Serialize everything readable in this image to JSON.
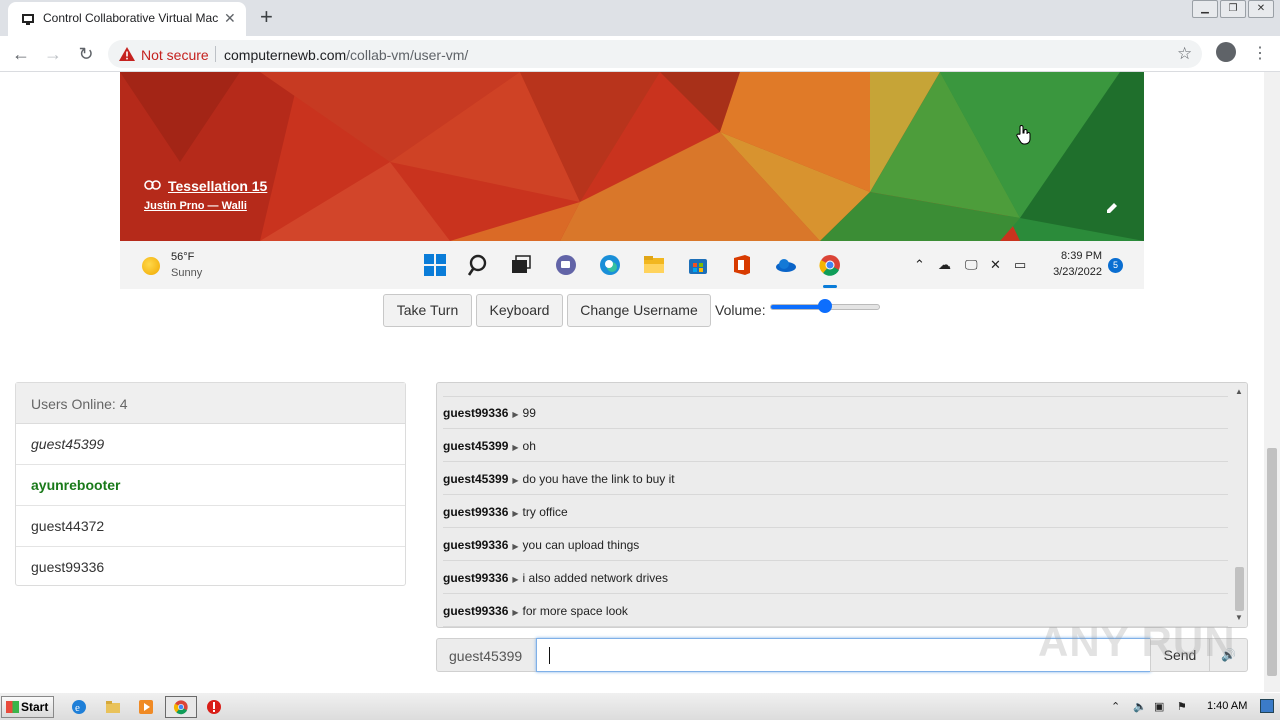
{
  "browser": {
    "tab_title": "Control Collaborative Virtual Machine",
    "security_label": "Not secure",
    "url_host": "computernewb.com",
    "url_path": "/collab-vm/user-vm/"
  },
  "vm": {
    "wallpaper": {
      "title": "Tessellation 15",
      "author": "Justin Prno — Walli"
    },
    "weather": {
      "temp": "56°F",
      "condition": "Sunny"
    },
    "taskbar_icons": [
      "windows-start-icon",
      "search-icon",
      "task-view-icon",
      "chat-icon",
      "edge-icon",
      "file-explorer-icon",
      "store-icon",
      "office-icon",
      "onedrive-icon",
      "chrome-icon"
    ],
    "clock": {
      "time": "8:39 PM",
      "date": "3/23/2022"
    },
    "notification_count": "5"
  },
  "controls": {
    "take_turn": "Take Turn",
    "keyboard": "Keyboard",
    "change_username": "Change Username",
    "volume_label": "Volume:",
    "volume_level": 0.5
  },
  "users": {
    "header": "Users Online: 4",
    "list": [
      "guest45399",
      "ayunrebooter",
      "guest44372",
      "guest99336"
    ]
  },
  "chat": {
    "messages": [
      {
        "user": "guest99336",
        "text": "99"
      },
      {
        "user": "guest45399",
        "text": "oh"
      },
      {
        "user": "guest45399",
        "text": "do you have the link to buy it"
      },
      {
        "user": "guest99336",
        "text": "try office"
      },
      {
        "user": "guest99336",
        "text": "you can upload things"
      },
      {
        "user": "guest99336",
        "text": "i also added network drives"
      },
      {
        "user": "guest99336",
        "text": "for more space look"
      }
    ],
    "input_username": "guest45399",
    "input_value": "",
    "send_label": "Send"
  },
  "watermark": "ANY RUN",
  "os_taskbar": {
    "start_label": "Start",
    "clock": "1:40 AM"
  },
  "colors": {
    "admin_user": "#1a7a1a",
    "accent": "#0d6efd",
    "warning": "#c5221f"
  }
}
